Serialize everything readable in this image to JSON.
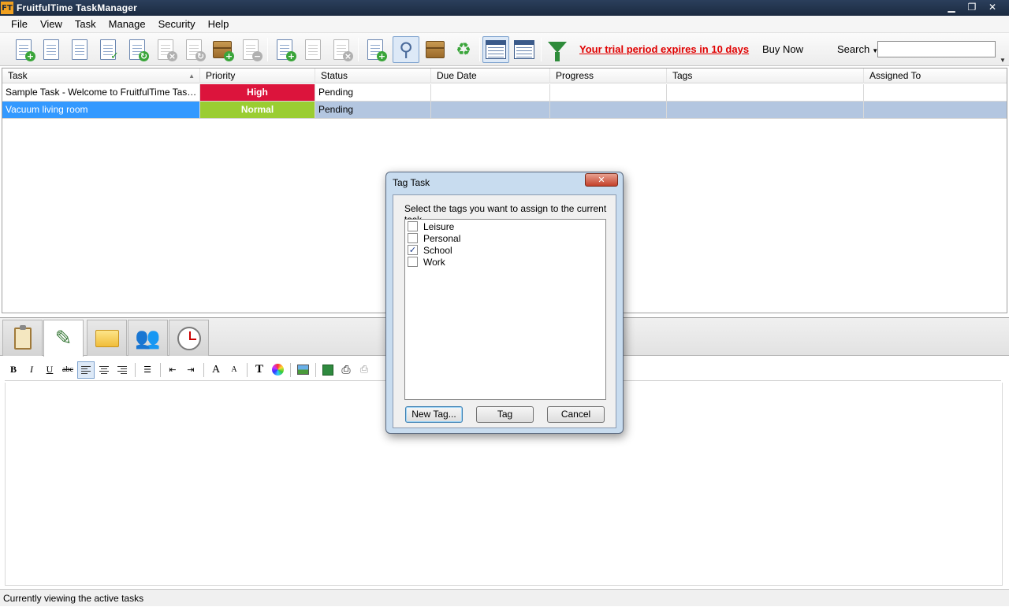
{
  "window": {
    "title": "FruitfulTime TaskManager",
    "logo": "FT",
    "minimize": "▁",
    "restore": "❐",
    "close": "✕"
  },
  "menu": [
    "File",
    "View",
    "Task",
    "Manage",
    "Security",
    "Help"
  ],
  "toolbar": {
    "trial_text": "Your trial period expires in 10 days",
    "buy_now": "Buy Now",
    "search_label": "Search",
    "search_value": "",
    "icons": [
      "new-task-icon",
      "task-list-icon",
      "edit-task-icon",
      "complete-task-icon",
      "recycle-task-icon",
      "delete-task-icon",
      "archive-icon",
      "add-box-icon",
      "remove-box-icon",
      "add-subtask-icon",
      "complete-subtask-icon",
      "delete-subtask-icon",
      "new-note-icon",
      "highlight-icon",
      "archive-box-icon",
      "recycle-bin-icon",
      "active-view-icon",
      "detail-view-icon",
      "filter-icon"
    ]
  },
  "grid": {
    "columns": [
      "Task",
      "Priority",
      "Status",
      "Due Date",
      "Progress",
      "Tags",
      "Assigned To"
    ],
    "rows": [
      {
        "task": "Sample Task - Welcome to FruitfulTime TaskManager",
        "priority": "High",
        "status": "Pending",
        "due": "",
        "progress": "",
        "tags": "",
        "assigned": ""
      },
      {
        "task": "Vacuum living room",
        "priority": "Normal",
        "status": "Pending",
        "due": "",
        "progress": "",
        "tags": "",
        "assigned": ""
      }
    ]
  },
  "colors": {
    "priority_high": "#dc143c",
    "priority_normal": "#9acd32",
    "selection": "#3399ff",
    "trial_link": "#e00000"
  },
  "panel_tabs": [
    "notes-tab-icon",
    "edit-tab-icon",
    "attachments-tab-icon",
    "contacts-tab-icon",
    "time-tab-icon"
  ],
  "editor_toolbar": {
    "bold": "B",
    "italic": "I",
    "underline": "U",
    "strike": "abc",
    "font_grow": "A",
    "font_shrink": "A",
    "font": "T"
  },
  "status": "Currently viewing the active tasks",
  "dialog": {
    "title": "Tag Task",
    "close": "✕",
    "prompt": "Select the tags you want to assign to the current task",
    "tags": [
      {
        "label": "Leisure",
        "checked": false
      },
      {
        "label": "Personal",
        "checked": false
      },
      {
        "label": "School",
        "checked": true
      },
      {
        "label": "Work",
        "checked": false
      }
    ],
    "check_mark": "✓",
    "buttons": {
      "new_tag": "New Tag...",
      "tag": "Tag",
      "cancel": "Cancel"
    }
  }
}
